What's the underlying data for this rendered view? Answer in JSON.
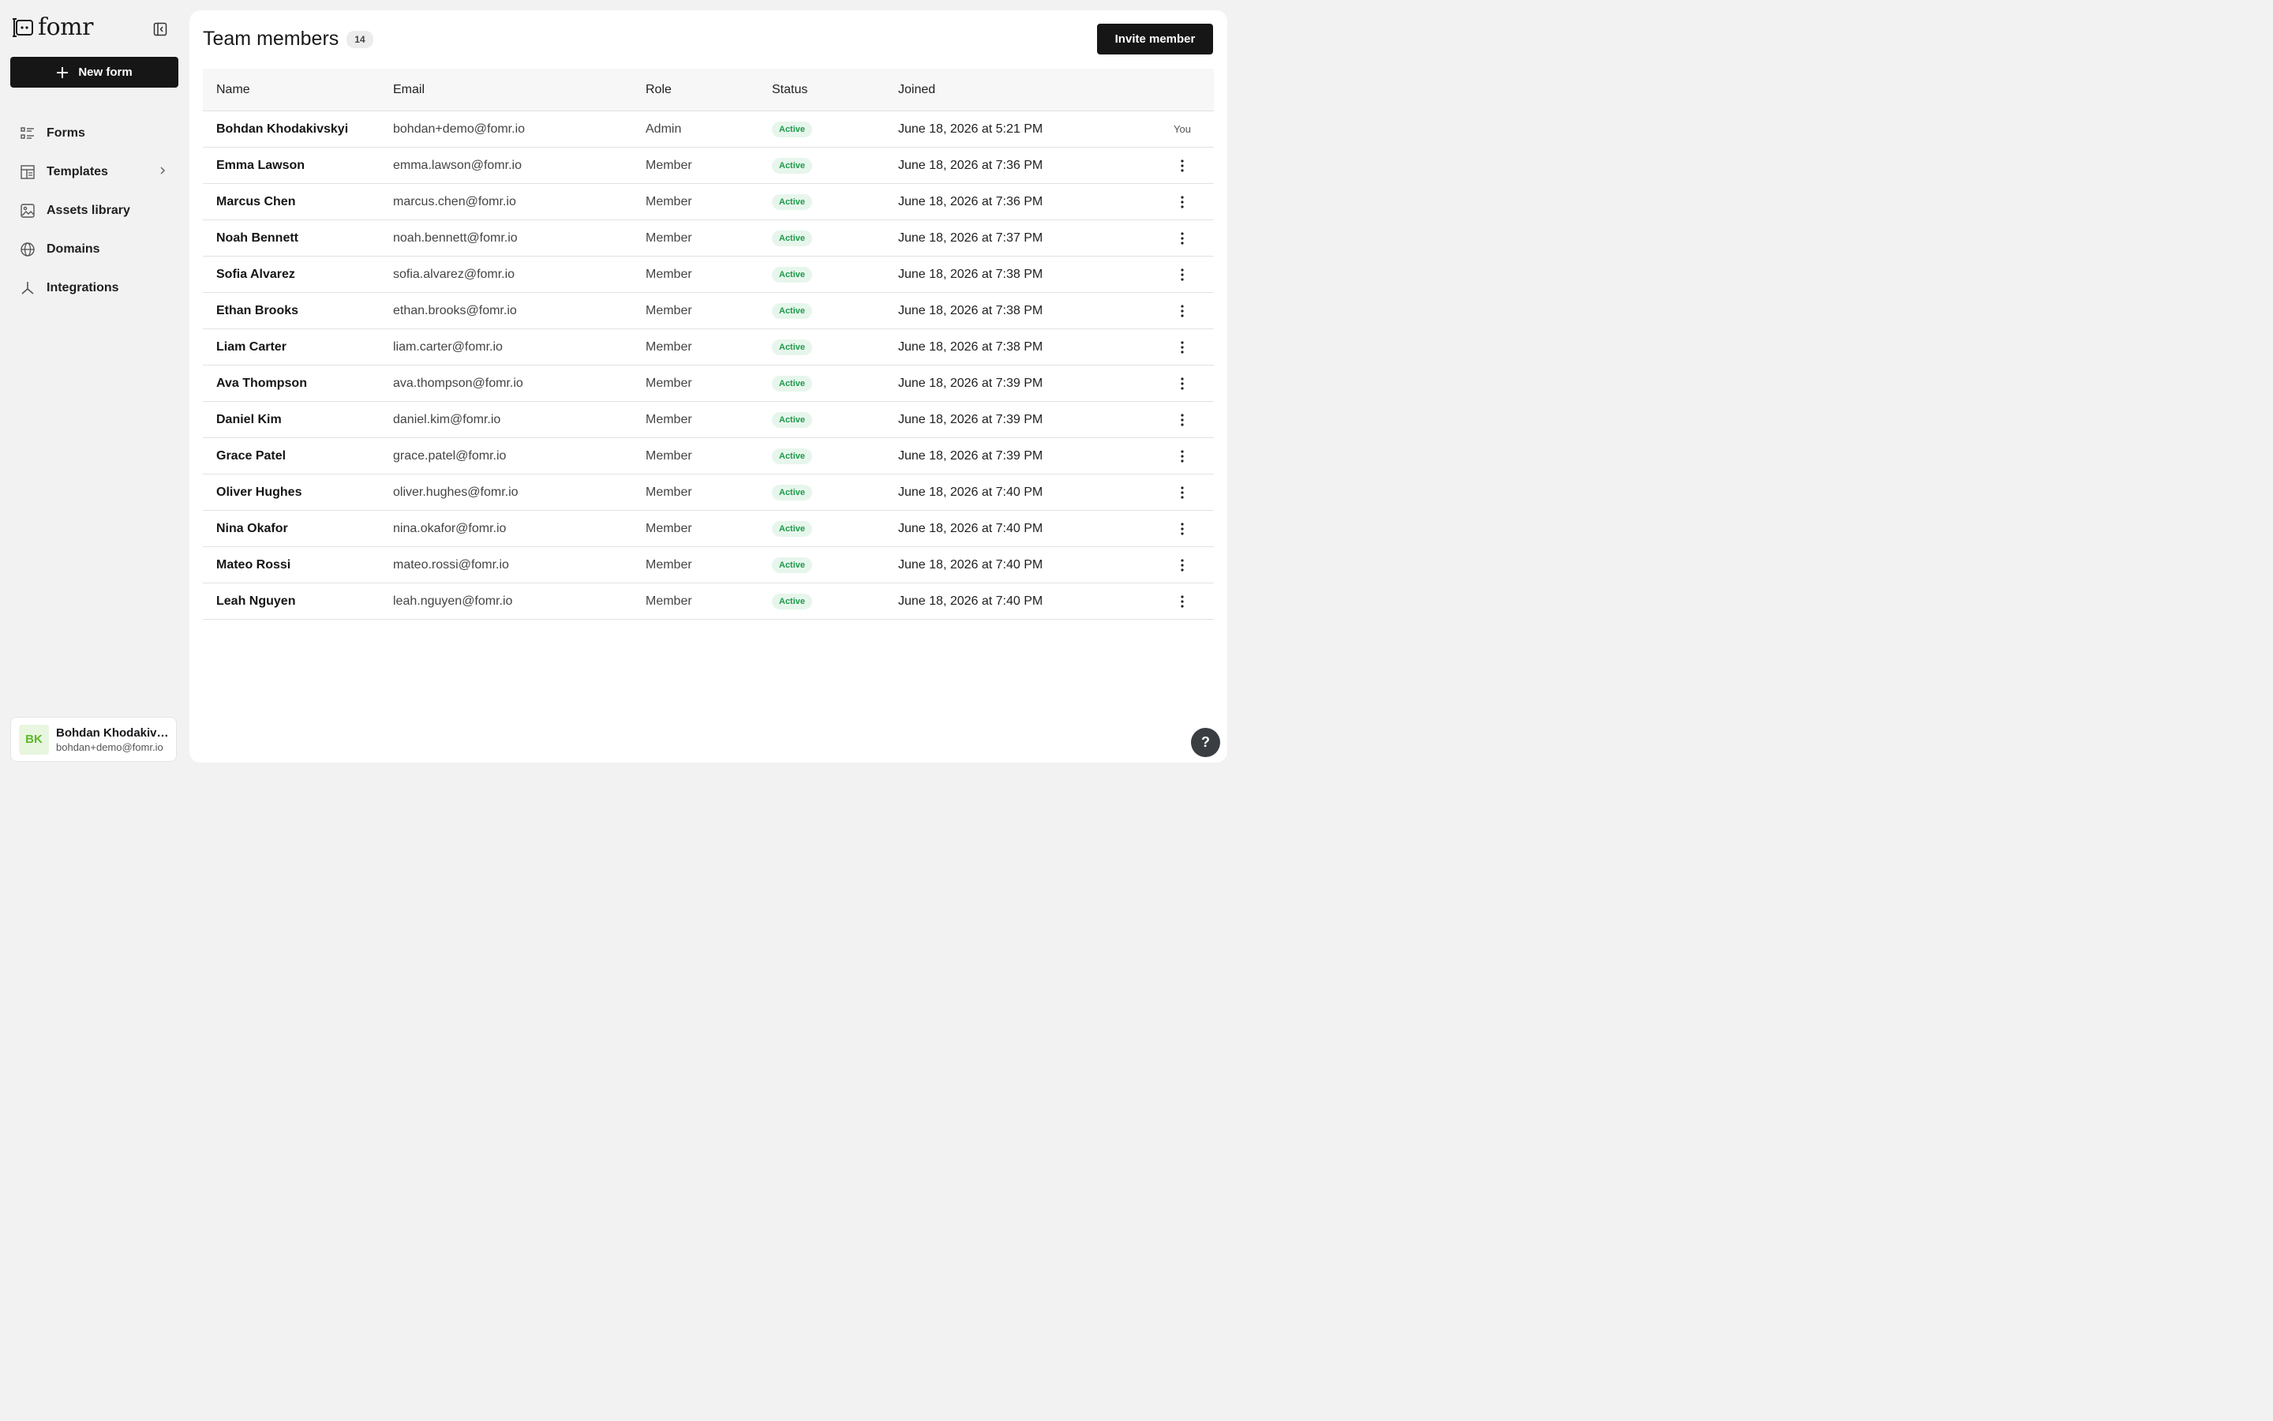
{
  "app": {
    "logo_text": "fomr"
  },
  "sidebar": {
    "new_form_label": "New form",
    "items": [
      {
        "label": "Forms",
        "icon": "list-icon"
      },
      {
        "label": "Templates",
        "icon": "templates-icon"
      },
      {
        "label": "Assets library",
        "icon": "image-icon"
      },
      {
        "label": "Domains",
        "icon": "globe-icon"
      },
      {
        "label": "Integrations",
        "icon": "integrations-icon"
      }
    ],
    "user": {
      "initials": "BK",
      "name": "Bohdan Khodakivskyi",
      "email": "bohdan+demo@fomr.io"
    }
  },
  "header": {
    "title": "Team members",
    "count": "14",
    "invite_label": "Invite member"
  },
  "table": {
    "columns": [
      "Name",
      "Email",
      "Role",
      "Status",
      "Joined"
    ],
    "rows": [
      {
        "name": "Bohdan Khodakivskyi",
        "email": "bohdan+demo@fomr.io",
        "role": "Admin",
        "status": "Active",
        "joined": "June 18, 2026 at 5:21 PM",
        "action": "You"
      },
      {
        "name": "Emma Lawson",
        "email": "emma.lawson@fomr.io",
        "role": "Member",
        "status": "Active",
        "joined": "June 18, 2026 at 7:36 PM"
      },
      {
        "name": "Marcus Chen",
        "email": "marcus.chen@fomr.io",
        "role": "Member",
        "status": "Active",
        "joined": "June 18, 2026 at 7:36 PM"
      },
      {
        "name": "Noah Bennett",
        "email": "noah.bennett@fomr.io",
        "role": "Member",
        "status": "Active",
        "joined": "June 18, 2026 at 7:37 PM"
      },
      {
        "name": "Sofia Alvarez",
        "email": "sofia.alvarez@fomr.io",
        "role": "Member",
        "status": "Active",
        "joined": "June 18, 2026 at 7:38 PM"
      },
      {
        "name": "Ethan Brooks",
        "email": "ethan.brooks@fomr.io",
        "role": "Member",
        "status": "Active",
        "joined": "June 18, 2026 at 7:38 PM"
      },
      {
        "name": "Liam Carter",
        "email": "liam.carter@fomr.io",
        "role": "Member",
        "status": "Active",
        "joined": "June 18, 2026 at 7:38 PM"
      },
      {
        "name": "Ava Thompson",
        "email": "ava.thompson@fomr.io",
        "role": "Member",
        "status": "Active",
        "joined": "June 18, 2026 at 7:39 PM"
      },
      {
        "name": "Daniel Kim",
        "email": "daniel.kim@fomr.io",
        "role": "Member",
        "status": "Active",
        "joined": "June 18, 2026 at 7:39 PM"
      },
      {
        "name": "Grace Patel",
        "email": "grace.patel@fomr.io",
        "role": "Member",
        "status": "Active",
        "joined": "June 18, 2026 at 7:39 PM"
      },
      {
        "name": "Oliver Hughes",
        "email": "oliver.hughes@fomr.io",
        "role": "Member",
        "status": "Active",
        "joined": "June 18, 2026 at 7:40 PM"
      },
      {
        "name": "Nina Okafor",
        "email": "nina.okafor@fomr.io",
        "role": "Member",
        "status": "Active",
        "joined": "June 18, 2026 at 7:40 PM"
      },
      {
        "name": "Mateo Rossi",
        "email": "mateo.rossi@fomr.io",
        "role": "Member",
        "status": "Active",
        "joined": "June 18, 2026 at 7:40 PM"
      },
      {
        "name": "Leah Nguyen",
        "email": "leah.nguyen@fomr.io",
        "role": "Member",
        "status": "Active",
        "joined": "June 18, 2026 at 7:40 PM"
      }
    ]
  },
  "help": {
    "label": "?"
  },
  "colors": {
    "primary": "#161616",
    "status_active_bg": "#e7f6ec",
    "status_active_text": "#1f9a4b",
    "avatar_bg": "#e9f6df",
    "avatar_text": "#5cb82b"
  }
}
